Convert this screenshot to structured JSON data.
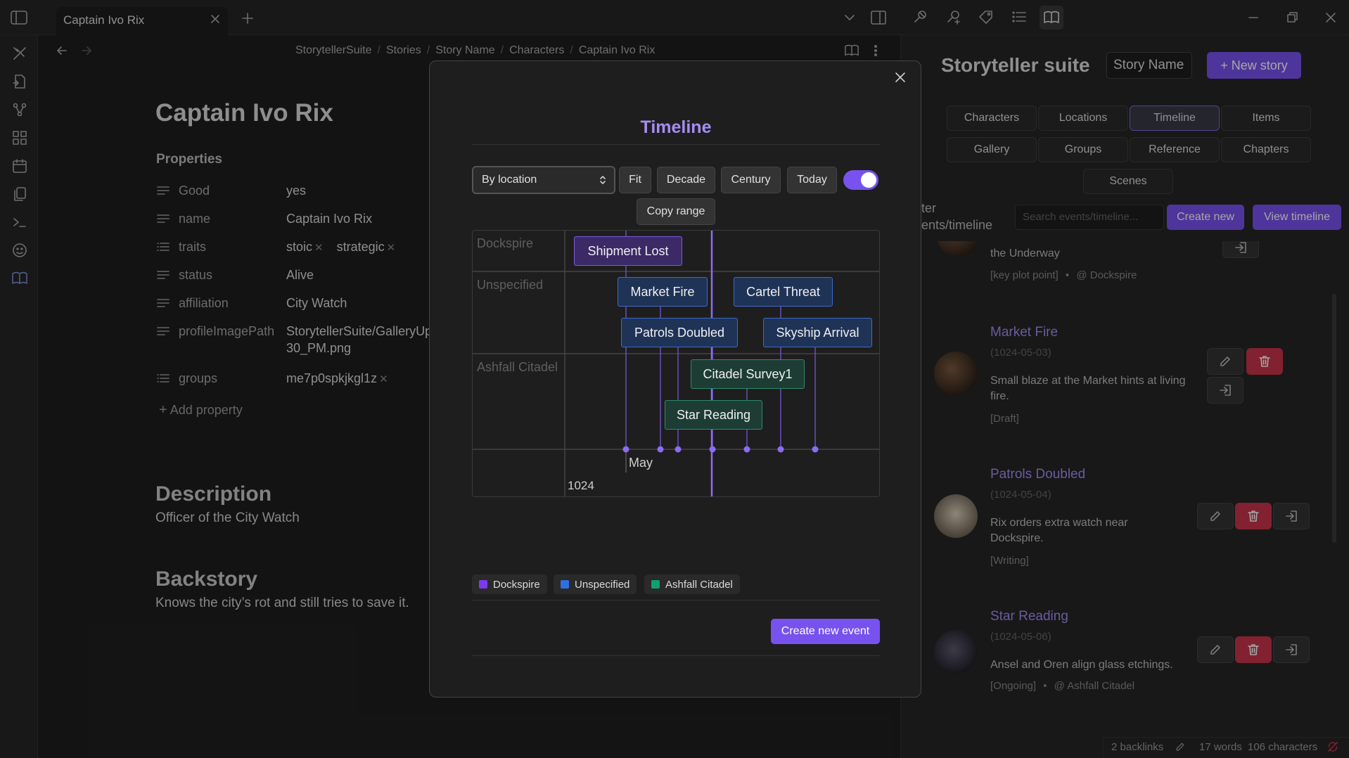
{
  "tab": {
    "title": "Captain Ivo Rix"
  },
  "breadcrumb": [
    "StorytellerSuite",
    "Stories",
    "Story Name",
    "Characters",
    "Captain Ivo Rix"
  ],
  "note": {
    "title": "Captain Ivo Rix",
    "properties_heading": "Properties",
    "properties": [
      {
        "key": "Good",
        "value": "yes"
      },
      {
        "key": "name",
        "value": "Captain Ivo Rix"
      },
      {
        "key": "traits",
        "values": [
          "stoic",
          "strategic"
        ]
      },
      {
        "key": "status",
        "value": "Alive"
      },
      {
        "key": "affiliation",
        "value": "City Watch"
      },
      {
        "key": "profileImagePath",
        "value": "StorytellerSuite/GalleryUpl",
        "value2": "30_PM.png"
      },
      {
        "key": "groups",
        "values": [
          "me7p0spkjkgl1z"
        ]
      }
    ],
    "add_property": "Add property",
    "description_heading": "Description",
    "description": "Officer of the City Watch",
    "backstory_heading": "Backstory",
    "backstory": "Knows the city’s rot and still tries to save it."
  },
  "sidebar": {
    "title": "Storyteller suite",
    "story_select": "Story Name",
    "new_story": "+ New story",
    "nav": [
      "Characters",
      "Locations",
      "Timeline",
      "Items",
      "Gallery",
      "Groups",
      "Reference",
      "Chapters",
      "Scenes"
    ],
    "active_nav": "Timeline",
    "filter_label_1": "ter",
    "filter_label_2": "ents/timeline",
    "search_placeholder": "Search events/timeline...",
    "create_new": "Create new",
    "view_timeline": "View timeline",
    "partial_event": {
      "desc": "the Underway",
      "tags": "[key plot point]",
      "sep": "•",
      "location": "@ Dockspire"
    },
    "events": [
      {
        "title": "Market Fire",
        "date": "(1024-05-03)",
        "desc1": "Small blaze at the Market hints at living",
        "desc2": "fire.",
        "tags": "[Draft]"
      },
      {
        "title": "Patrols Doubled",
        "date": "(1024-05-04)",
        "desc1": "Rix orders extra watch near",
        "desc2": "Dockspire.",
        "tags": "[Writing]"
      },
      {
        "title": "Star Reading",
        "date": "(1024-05-06)",
        "desc1": "Ansel and Oren align glass etchings.",
        "tags": "[Ongoing]",
        "sep": "•",
        "location": "@ Ashfall Citadel"
      }
    ]
  },
  "modal": {
    "title": "Timeline",
    "group_select": "By location",
    "buttons": {
      "fit": "Fit",
      "decade": "Decade",
      "century": "Century",
      "today": "Today",
      "copy_range": "Copy range"
    },
    "toggle_on": true,
    "lanes": [
      "Dockspire",
      "Unspecified",
      "Ashfall Citadel"
    ],
    "events": [
      {
        "label": "Shipment Lost",
        "lane": "Dockspire",
        "color": "purple"
      },
      {
        "label": "Market Fire",
        "lane": "Unspecified",
        "color": "blue"
      },
      {
        "label": "Cartel Threat",
        "lane": "Unspecified",
        "color": "blue"
      },
      {
        "label": "Patrols Doubled",
        "lane": "Unspecified",
        "color": "blue"
      },
      {
        "label": "Skyship Arrival",
        "lane": "Unspecified",
        "color": "blue"
      },
      {
        "label": "Citadel Survey1",
        "lane": "Ashfall Citadel",
        "color": "green"
      },
      {
        "label": "Star Reading",
        "lane": "Ashfall Citadel",
        "color": "green"
      }
    ],
    "axis_month": "May",
    "axis_year": "1024",
    "legend": [
      {
        "name": "Dockspire",
        "color": "#7c3aed"
      },
      {
        "name": "Unspecified",
        "color": "#2f6fe0"
      },
      {
        "name": "Ashfall Citadel",
        "color": "#10a070"
      }
    ],
    "create_event": "Create new event"
  },
  "status_bar": {
    "backlinks": "2 backlinks",
    "words": "17 words",
    "chars": "106 characters"
  },
  "colors": {
    "accent": "#7852ee",
    "danger": "#c8344a",
    "bg": "#1e1e1e"
  }
}
